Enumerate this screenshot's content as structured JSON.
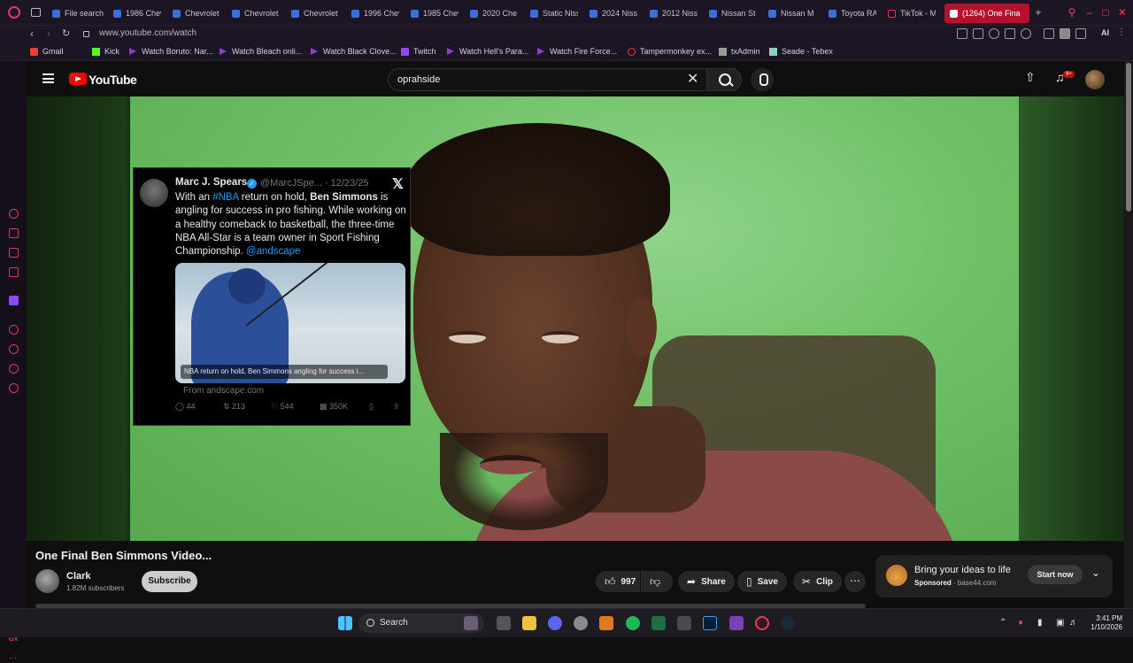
{
  "browser": {
    "tabs": [
      {
        "label": "File search"
      },
      {
        "label": "1986 Chev"
      },
      {
        "label": "Chevrolet"
      },
      {
        "label": "Chevrolet"
      },
      {
        "label": "Chevrolet"
      },
      {
        "label": "1996 Chev"
      },
      {
        "label": "1985 Chev"
      },
      {
        "label": "2020 Che"
      },
      {
        "label": "Static Niss"
      },
      {
        "label": "2024 Niss"
      },
      {
        "label": "2012 Niss"
      },
      {
        "label": "Nissan St"
      },
      {
        "label": "Nissan M"
      },
      {
        "label": "Toyota RA"
      },
      {
        "label": "TikTok - M"
      },
      {
        "label": "(1264) One Fina"
      }
    ],
    "url": "www.youtube.com/watch",
    "ai_label": "AI",
    "bookmarks": [
      {
        "label": "Gmail",
        "color": "#ea4335"
      },
      {
        "label": "Kick",
        "color": "#53fc18"
      },
      {
        "label": "Watch Boruto: Nar...",
        "color": "#8b3fd6"
      },
      {
        "label": "Watch Bleach onli...",
        "color": "#8b3fd6"
      },
      {
        "label": "Watch Black Clove...",
        "color": "#8b3fd6"
      },
      {
        "label": "Twitch",
        "color": "#9146ff"
      },
      {
        "label": "Watch Hell's Para...",
        "color": "#8b3fd6"
      },
      {
        "label": "Watch Fire Force...",
        "color": "#8b3fd6"
      },
      {
        "label": "Tampermonkey ex...",
        "color": "#e23a3a"
      },
      {
        "label": "txAdmin",
        "color": "#9a9a9a"
      },
      {
        "label": "Seade - Tebex",
        "color": "#8bd0c0"
      }
    ],
    "sidebar_gx": "GX"
  },
  "youtube": {
    "logo_text": "YouTube",
    "search_value": "oprahside",
    "notification_badge": "9+",
    "video": {
      "title": "One Final Ben Simmons Video...",
      "channel": "Clark",
      "subscribers": "1.82M subscribers",
      "subscribe_label": "Subscribe",
      "likes": "997",
      "share_label": "Share",
      "save_label": "Save",
      "clip_label": "Clip"
    },
    "tweet": {
      "name": "Marc J. Spears",
      "handle_date": "@MarcJSpe... · 12/23/25",
      "text_parts": {
        "p1": "With an ",
        "hashtag": "#NBA",
        "p2": " return on hold, ",
        "bold": "Ben Simmons",
        "p3": " is angling for success in pro fishing.  While working on a healthy comeback to basketball, the three-time NBA All-Star is a team owner in Sport Fishing Championship. ",
        "mention": "@andscape"
      },
      "image_caption": "NBA return on hold, Ben Simmons angling for success i...",
      "from": "From andscape.com",
      "replies": "44",
      "retweets": "213",
      "likes": "544",
      "views": "350K"
    },
    "ad": {
      "title": "Bring your ideas to life",
      "sponsored": "Sponsored",
      "domain": " · base44.com",
      "cta": "Start now"
    }
  },
  "taskbar": {
    "search_label": "Search",
    "time": "3:41 PM",
    "date": "1/10/2026"
  }
}
